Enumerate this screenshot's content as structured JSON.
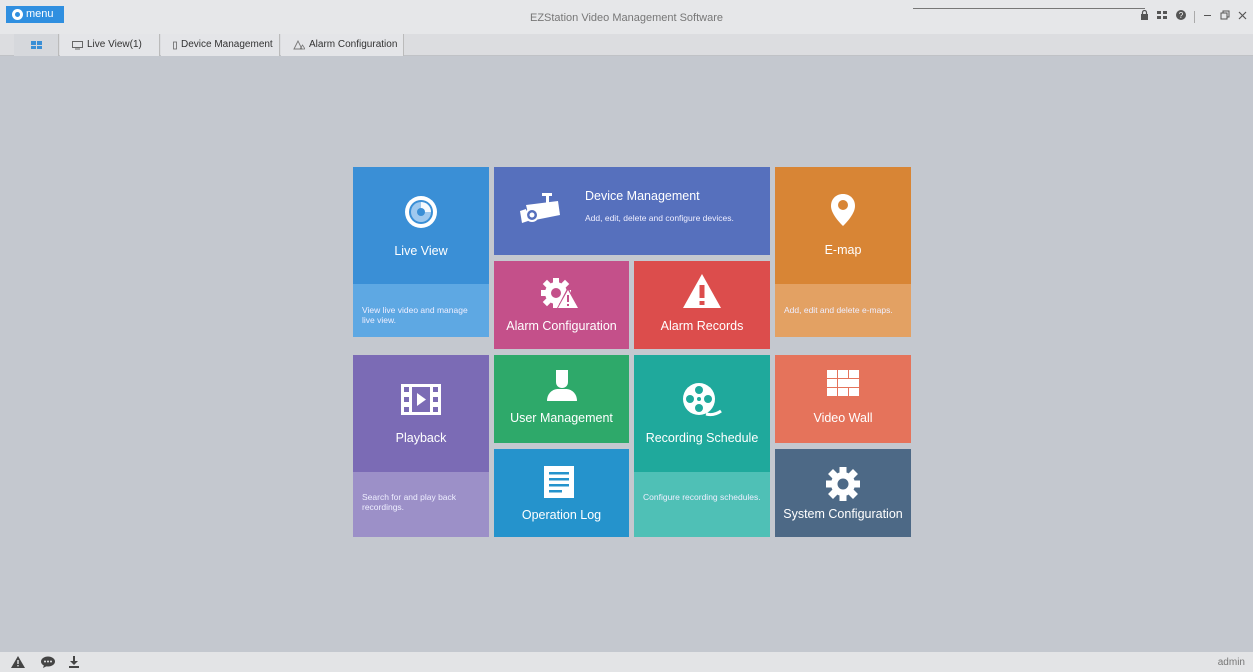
{
  "app": {
    "menu_label": "menu",
    "title": "EZStation Video Management Software",
    "window_controls": [
      "lock-icon",
      "layout-icon",
      "help-icon",
      "minimize-icon",
      "restore-icon",
      "close-icon"
    ]
  },
  "tabs": [
    {
      "icon": "grid-icon"
    },
    {
      "label": "Live View(1)",
      "icon": "monitor-icon"
    },
    {
      "label": "Device Management",
      "icon": "device-icon"
    },
    {
      "label": "Alarm Configuration",
      "icon": "alarm-config-icon"
    }
  ],
  "tiles": {
    "live_view": {
      "label": "Live View",
      "desc": "View live video and manage live view.",
      "color": "#3a8fd6",
      "desc_color": "#5ea8e3",
      "icon": "live-view-icon"
    },
    "device_management": {
      "label": "Device Management",
      "desc": "Add, edit, delete and configure devices.",
      "color": "#5670bd",
      "icon": "camera-icon"
    },
    "emap": {
      "label": "E-map",
      "desc": "Add, edit and delete e-maps.",
      "color": "#d88535",
      "desc_color": "#e3a163",
      "icon": "map-pin-icon"
    },
    "alarm_configuration": {
      "label": "Alarm Configuration",
      "color": "#c4508a",
      "icon": "alarm-config-icon"
    },
    "alarm_records": {
      "label": "Alarm Records",
      "color": "#dc4d4c",
      "icon": "warning-icon"
    },
    "playback": {
      "label": "Playback",
      "desc": "Search for and play back recordings.",
      "color": "#7b6bb5",
      "desc_color": "#9c90c8",
      "icon": "film-icon"
    },
    "user_management": {
      "label": "User Management",
      "color": "#2ea96a",
      "icon": "user-icon"
    },
    "recording_schedule": {
      "label": "Recording Schedule",
      "desc": "Configure recording schedules.",
      "color": "#1fa99c",
      "desc_color": "#4fc0b6",
      "icon": "film-reel-icon"
    },
    "video_wall": {
      "label": "Video Wall",
      "color": "#e5735b",
      "icon": "video-wall-icon"
    },
    "operation_log": {
      "label": "Operation Log",
      "color": "#2593cc",
      "icon": "document-icon"
    },
    "system_configuration": {
      "label": "System Configuration",
      "color": "#4d6986",
      "icon": "gear-icon"
    }
  },
  "status": {
    "icons": [
      "alert-icon",
      "chat-icon",
      "download-icon"
    ],
    "user": "admin"
  }
}
